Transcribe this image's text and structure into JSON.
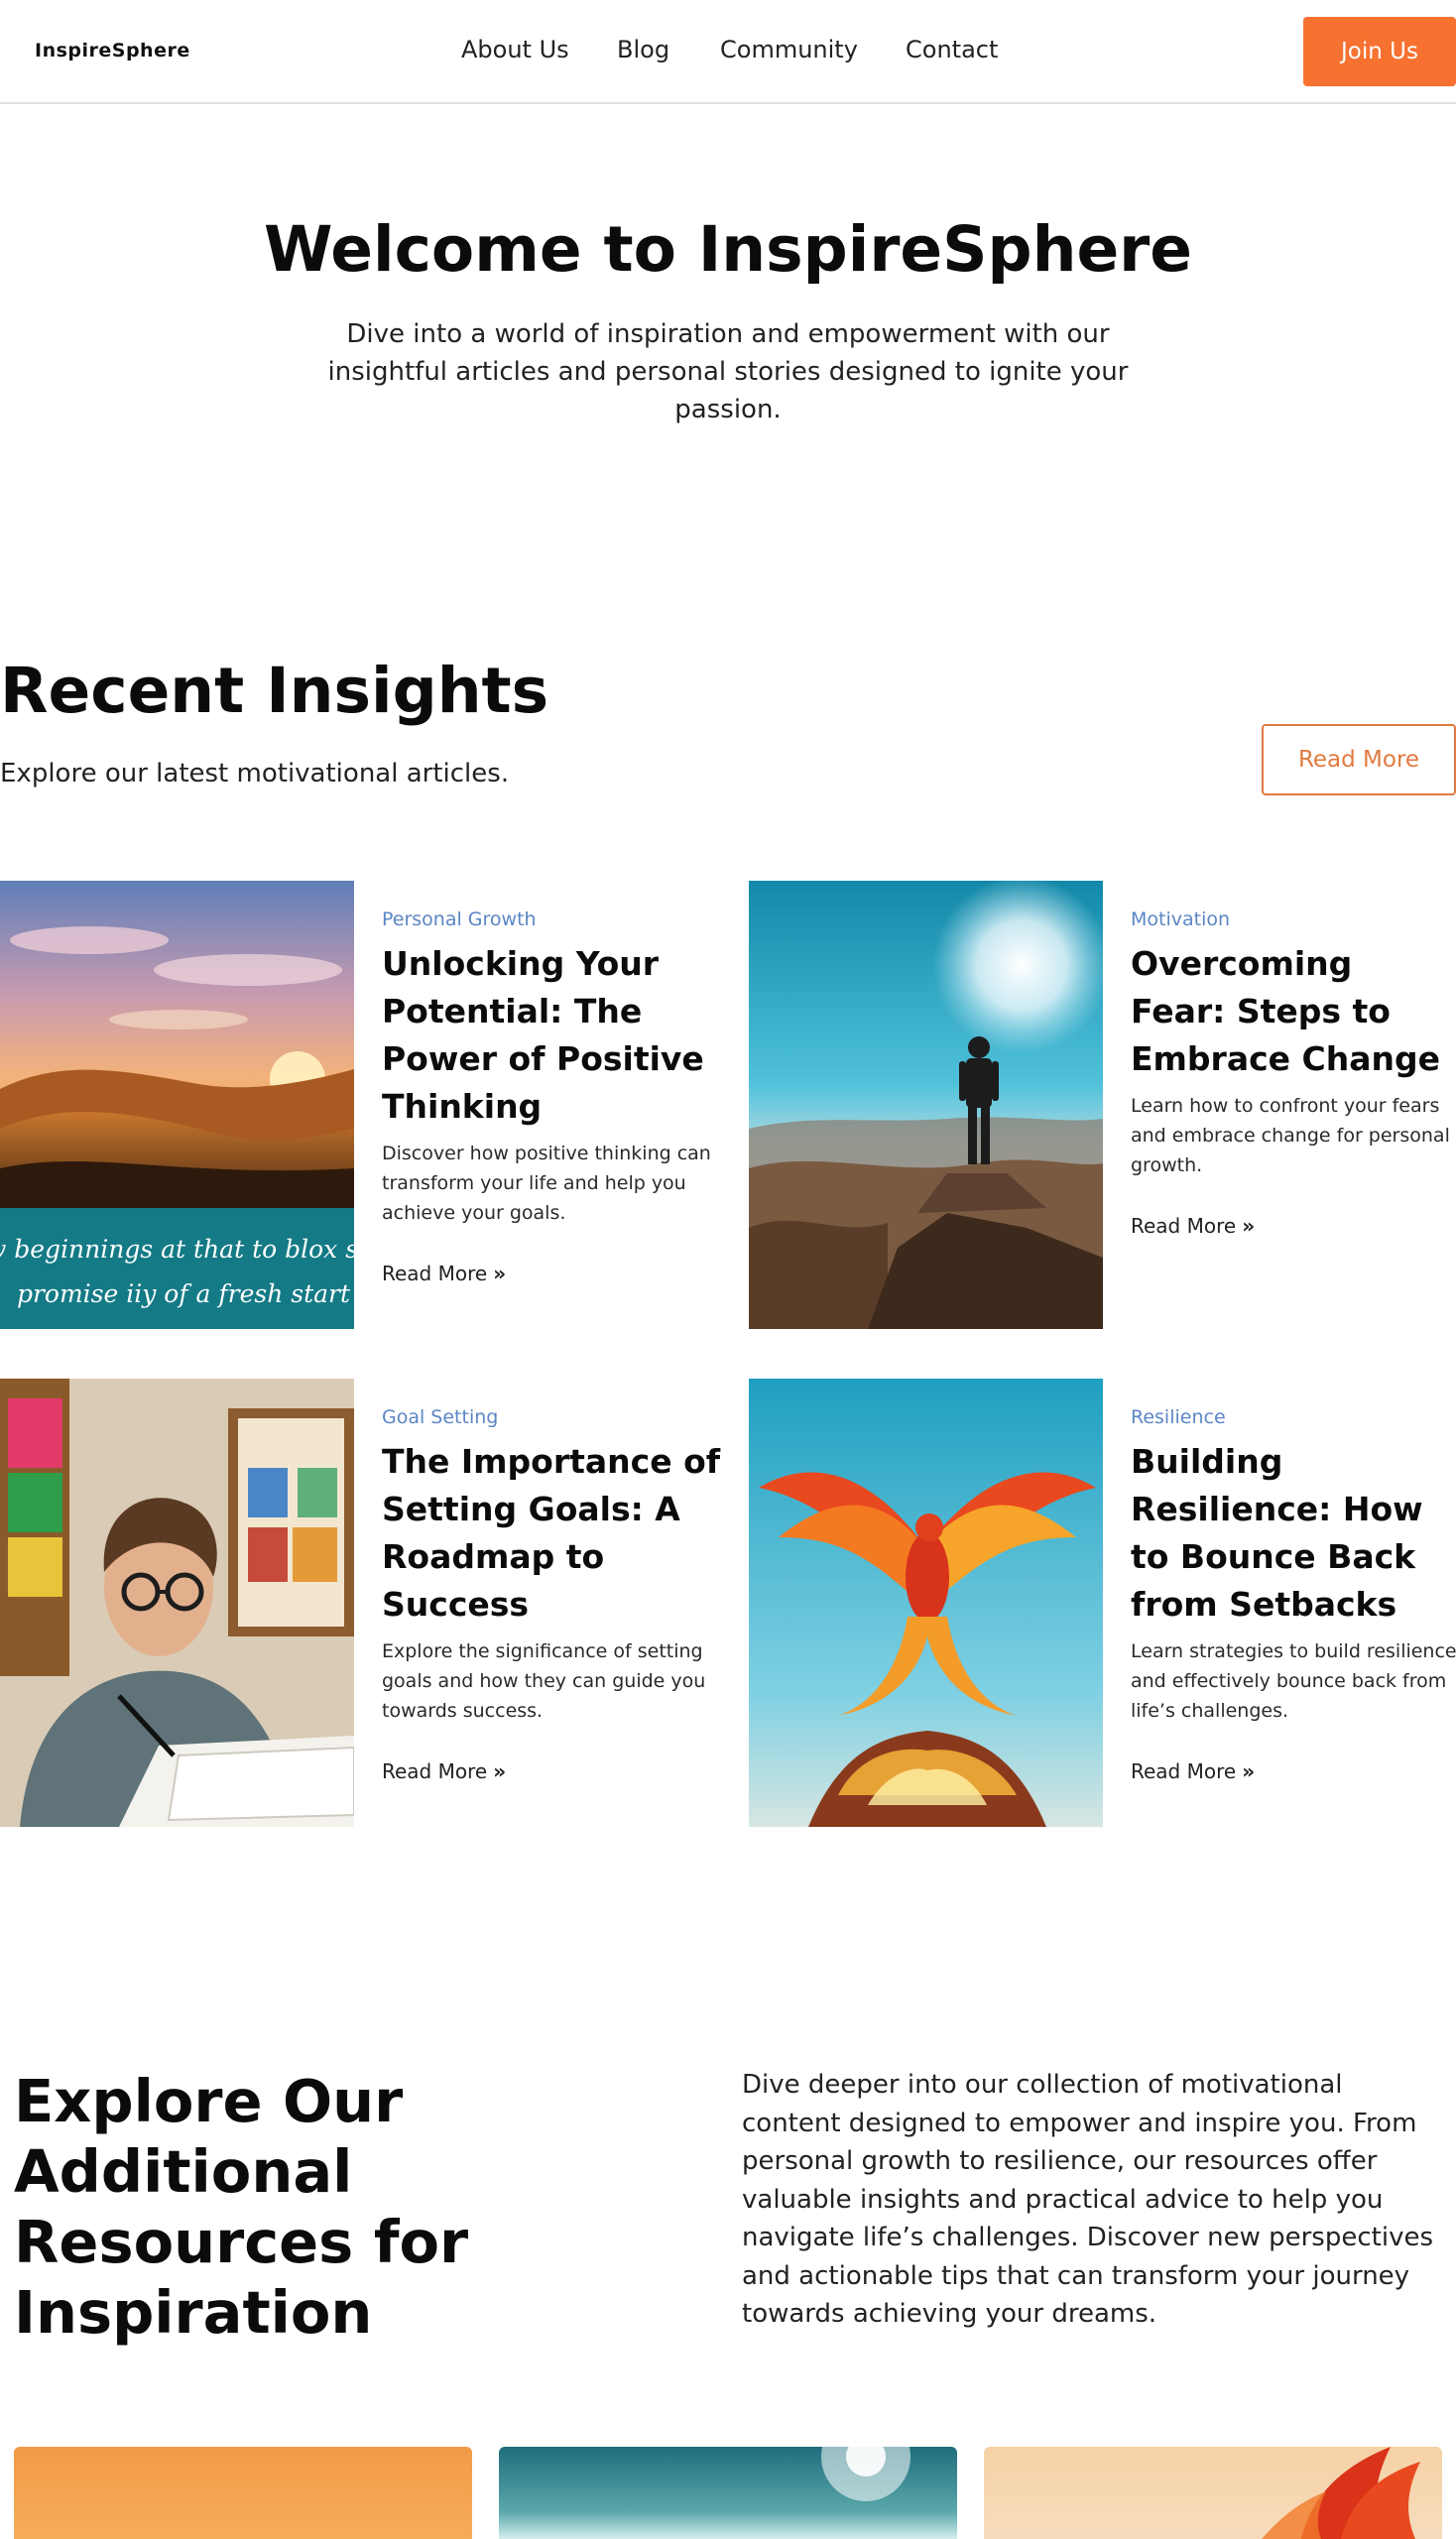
{
  "header": {
    "logo": "InspireSphere",
    "nav": [
      "About Us",
      "Blog",
      "Community",
      "Contact"
    ],
    "join_label": "Join Us"
  },
  "hero": {
    "title": "Welcome to InspireSphere",
    "subtitle": "Dive into a world of inspiration and empowerment with our insightful articles and personal stories designed to ignite your passion."
  },
  "insights": {
    "title": "Recent Insights",
    "subtitle": "Explore our latest motivational articles.",
    "read_more_label": "Read More",
    "articles": [
      {
        "category": "Personal Growth",
        "title": "Unlocking Your Potential: The Power of Positive Thinking",
        "description": "Discover how positive thinking can transform your life and help you achieve your goals.",
        "link": "Read More",
        "image_caption_line1": "w beginnings at that to blox st",
        "image_caption_line2": "promise iiy of a fresh start"
      },
      {
        "category": "Motivation",
        "title": "Overcoming Fear: Steps to Embrace Change",
        "description": "Learn how to confront your fears and embrace change for personal growth.",
        "link": "Read More"
      },
      {
        "category": "Goal Setting",
        "title": "The Importance of Setting Goals: A Roadmap to Success",
        "description": "Explore the significance of setting goals and how they can guide you towards success.",
        "link": "Read More"
      },
      {
        "category": "Resilience",
        "title": "Building Resilience: How to Bounce Back from Setbacks",
        "description": "Learn strategies to build resilience and effectively bounce back from life’s challenges.",
        "link": "Read More"
      }
    ]
  },
  "resources": {
    "title": "Explore Our Additional Resources for Inspiration",
    "text": "Dive deeper into our collection of motivational content designed to empower and inspire you. From personal growth to resilience, our resources offer valuable insights and practical advice to help you navigate life’s challenges. Discover new perspectives and actionable tips that can transform your journey towards achieving your dreams."
  },
  "colors": {
    "accent": "#f77130",
    "tag": "#5b86c4",
    "outline": "#e07a3f"
  },
  "icons": {
    "read_more_arrow": "double-chevron-right-icon"
  }
}
